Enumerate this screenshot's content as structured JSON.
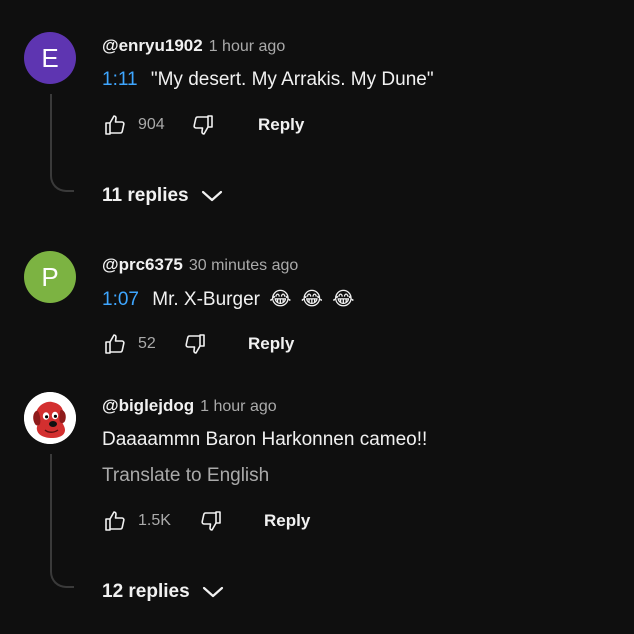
{
  "comments": [
    {
      "avatar_letter": "E",
      "avatar_color": "#5e35b1",
      "author": "@enryu1902",
      "time": "1 hour ago",
      "timestamp": "1:11",
      "text": "\"My desert. My Arrakis. My Dune\"",
      "likes": "904",
      "reply_label": "Reply",
      "replies_label": "11 replies"
    },
    {
      "avatar_letter": "P",
      "avatar_color": "#7cb342",
      "author": "@prc6375",
      "time": "30 minutes ago",
      "timestamp": "1:07",
      "text": "Mr. X-Burger",
      "emoji": "😂",
      "likes": "52",
      "reply_label": "Reply"
    },
    {
      "avatar_icon": "red-dog-avatar-icon",
      "author": "@biglejdog",
      "time": "1 hour ago",
      "text": "Daaaammn Baron Harkonnen cameo!!",
      "translate_label": "Translate to English",
      "likes": "1.5K",
      "reply_label": "Reply",
      "replies_label": "12 replies"
    }
  ],
  "colors": {
    "background": "#0f0f0f",
    "text": "#f1f1f1",
    "secondary_text": "#aaaaaa",
    "link": "#3ea6ff"
  }
}
